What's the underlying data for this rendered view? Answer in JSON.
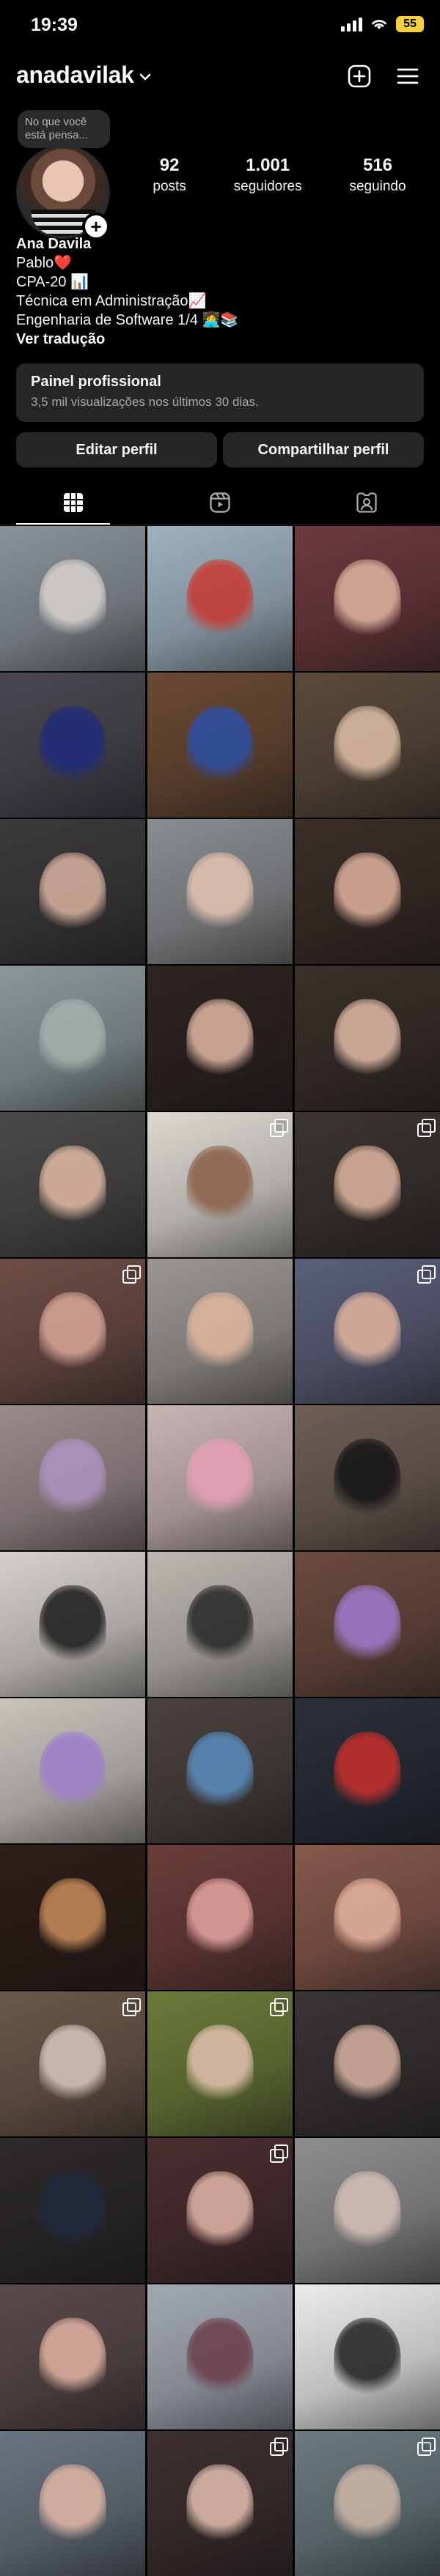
{
  "status_bar": {
    "time": "19:39",
    "battery": "55"
  },
  "header": {
    "username": "anadavilak"
  },
  "profile": {
    "note": "No que você está pensa...",
    "stats": [
      {
        "value": "92",
        "label": "posts"
      },
      {
        "value": "1.001",
        "label": "seguidores"
      },
      {
        "value": "516",
        "label": "seguindo"
      }
    ],
    "name": "Ana Davila",
    "bio_lines": [
      "Pablo❤️",
      "CPA-20 📊",
      "Técnica em Administração📈",
      "Engenharia de Software 1/4 👩‍💻📚"
    ],
    "translate_link": "Ver tradução"
  },
  "pro_panel": {
    "title": "Painel profissional",
    "subtitle": "3,5 mil visualizações nos últimos 30 dias."
  },
  "actions": {
    "edit": "Editar perfil",
    "share": "Compartilhar perfil"
  },
  "tabs": [
    {
      "icon": "grid-icon",
      "active": true
    },
    {
      "icon": "reels-icon",
      "active": false
    },
    {
      "icon": "tagged-icon",
      "active": false
    }
  ],
  "posts": [
    {
      "bg": "#8a9298",
      "accent": "#d9d4cf",
      "multi": false
    },
    {
      "bg": "#9fb2c0",
      "accent": "#c9382f",
      "multi": false
    },
    {
      "bg": "#6c3a3f",
      "accent": "#e3b7a2",
      "multi": false
    },
    {
      "bg": "#4a4750",
      "accent": "#1d2a7a",
      "multi": false
    },
    {
      "bg": "#6a4a34",
      "accent": "#2c4fa8",
      "multi": false
    },
    {
      "bg": "#5a4a3c",
      "accent": "#e0c0a8",
      "multi": false
    },
    {
      "bg": "#3d3a3b",
      "accent": "#d9b3a0",
      "multi": false
    },
    {
      "bg": "#8a8d90",
      "accent": "#e7c4b1",
      "multi": false
    },
    {
      "bg": "#3b2e29",
      "accent": "#e2b39f",
      "multi": false
    },
    {
      "bg": "#8c9798",
      "accent": "#a7b2b0",
      "multi": false
    },
    {
      "bg": "#2e2522",
      "accent": "#e1b8a6",
      "multi": false
    },
    {
      "bg": "#3a302b",
      "accent": "#e2bca9",
      "multi": false
    },
    {
      "bg": "#4b4a48",
      "accent": "#e3bba5",
      "multi": false
    },
    {
      "bg": "#dcd8d2",
      "accent": "#8a5e46",
      "multi": true
    },
    {
      "bg": "#3b3431",
      "accent": "#e2b7a2",
      "multi": true
    },
    {
      "bg": "#6e4d46",
      "accent": "#d9a899",
      "multi": true
    },
    {
      "bg": "#9b9691",
      "accent": "#e1b89e",
      "multi": false
    },
    {
      "bg": "#5b5f79",
      "accent": "#e3b59f",
      "multi": true
    },
    {
      "bg": "#9b8a8c",
      "accent": "#ae94c2",
      "multi": false
    },
    {
      "bg": "#c9b4b4",
      "accent": "#e8a0b8",
      "multi": false
    },
    {
      "bg": "#6e5e56",
      "accent": "#141414",
      "multi": false
    },
    {
      "bg": "#d4d0cb",
      "accent": "#1a1a1a",
      "multi": false
    },
    {
      "bg": "#bcb8b2",
      "accent": "#262626",
      "multi": false
    },
    {
      "bg": "#6b4a40",
      "accent": "#a07ccf",
      "multi": false
    },
    {
      "bg": "#c8c3bd",
      "accent": "#9d7dcc",
      "multi": false
    },
    {
      "bg": "#4a423e",
      "accent": "#5a8fc2",
      "multi": false
    },
    {
      "bg": "#2a2f3a",
      "accent": "#c9302c",
      "multi": false
    },
    {
      "bg": "#2e1f1a",
      "accent": "#c98c5a",
      "multi": false
    },
    {
      "bg": "#6a3d3a",
      "accent": "#e6a7a3",
      "multi": false
    },
    {
      "bg": "#86594c",
      "accent": "#e6b3a0",
      "multi": false
    },
    {
      "bg": "#6b574a",
      "accent": "#d9c8c0",
      "multi": true
    },
    {
      "bg": "#6b7a3a",
      "accent": "#e3c2b0",
      "multi": true
    },
    {
      "bg": "#3a3434",
      "accent": "#d9b3a2",
      "multi": false
    },
    {
      "bg": "#2e2a2c",
      "accent": "#1f2a3f",
      "multi": false
    },
    {
      "bg": "#4a2e30",
      "accent": "#e3b7a8",
      "multi": true
    },
    {
      "bg": "#8e8e8e",
      "accent": "#d8c2b8",
      "multi": false
    },
    {
      "bg": "#5a4a4a",
      "accent": "#e2b4a4",
      "multi": false
    },
    {
      "bg": "#a3a9b3",
      "accent": "#6b3d4a",
      "multi": false
    },
    {
      "bg": "#ececec",
      "accent": "#1f1f1f",
      "multi": false
    },
    {
      "bg": "#6a7480",
      "accent": "#e3b9a6",
      "multi": false
    },
    {
      "bg": "#3e3030",
      "accent": "#e4c0b1",
      "multi": true
    },
    {
      "bg": "#6b7a7e",
      "accent": "#cfb7a8",
      "multi": true
    }
  ]
}
